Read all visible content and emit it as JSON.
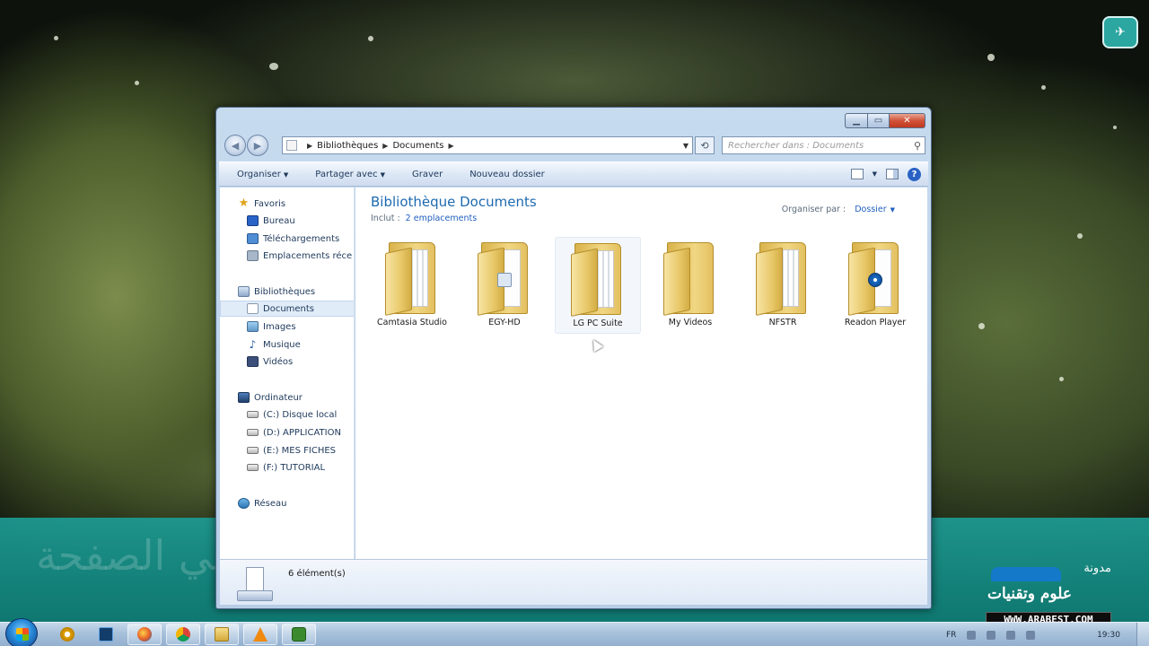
{
  "window": {
    "address": {
      "crumbs": [
        "Bibliothèques",
        "Documents"
      ]
    },
    "search_placeholder": "Rechercher dans : Documents",
    "command_bar": {
      "organize": "Organiser",
      "share": "Partager avec",
      "burn": "Graver",
      "new_folder": "Nouveau dossier"
    },
    "nav": {
      "favorites_header": "Favoris",
      "favorites": [
        "Bureau",
        "Téléchargements",
        "Emplacements réce"
      ],
      "libraries_header": "Bibliothèques",
      "libraries": [
        "Documents",
        "Images",
        "Musique",
        "Vidéos"
      ],
      "computer_header": "Ordinateur",
      "drives": [
        "(C:) Disque local",
        "(D:) APPLICATION",
        "(E:) MES FICHES",
        "(F:) TUTORIAL"
      ],
      "network": "Réseau"
    },
    "content": {
      "title": "Bibliothèque Documents",
      "includes_label": "Inclut :",
      "includes_link": "2 emplacements",
      "arrange_label": "Organiser par :",
      "arrange_value": "Dossier",
      "folders": [
        {
          "name": "Camtasia Studio",
          "icon": "folder-icon"
        },
        {
          "name": "EGY-HD",
          "icon": "folder-icon"
        },
        {
          "name": "LG PC Suite",
          "icon": "folder-icon"
        },
        {
          "name": "My Videos",
          "icon": "folder-icon"
        },
        {
          "name": "NFSTR",
          "icon": "folder-icon"
        },
        {
          "name": "Readon Player",
          "icon": "folder-icon"
        }
      ]
    },
    "status": {
      "item_count": "6 élément(s)"
    }
  },
  "desktop": {
    "logo_text_1": "مدونة",
    "logo_text_2": "علوم وتقنيات",
    "logo_url": "WWW.ARABEST.COM",
    "banner_text": "يتوجد في الصفحة"
  },
  "taskbar": {
    "language": "FR",
    "time": "19:30"
  },
  "colors": {
    "title_blue": "#1e6ab0",
    "link_blue": "#1f5fbf",
    "banner_teal": "#1d9a92",
    "close_red": "#c0391f"
  }
}
